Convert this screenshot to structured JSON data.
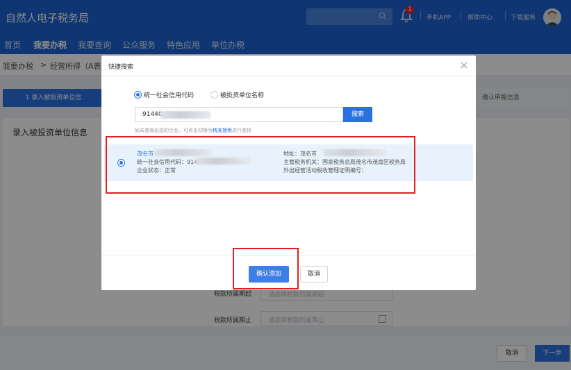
{
  "header": {
    "logo": "自然人电子税务局",
    "notification_count": "1",
    "links": [
      "手机APP",
      "帮助中心",
      "下载服务"
    ]
  },
  "nav": [
    "首页",
    "我要办税",
    "我要查询",
    "公众服务",
    "特色应用",
    "单位办税"
  ],
  "breadcrumb": {
    "root": "我要办税",
    "sep": ">",
    "current": "经营所得（A表"
  },
  "steps": {
    "active": "1  录入被投资单位信",
    "right": "确认申报信息"
  },
  "panel": {
    "title": "录入被投资单位信息",
    "period_start_label": "税款所属期起",
    "period_start_placeholder": "请选择税款所属期起",
    "period_end_label": "税款所属期止",
    "period_end_placeholder": "请选择税款所属期止"
  },
  "footer": {
    "cancel": "取消",
    "next": "下一步"
  },
  "modal": {
    "title": "快捷搜索",
    "radio_options": [
      {
        "label": "统一社会信用代码",
        "checked": true
      },
      {
        "label": "被投资单位名称",
        "checked": false
      }
    ],
    "query_value": "91440",
    "search_button": "搜索",
    "hint_prefix": "如未查询出您的企业，可点击切换为",
    "hint_link": "精准搜索",
    "hint_suffix": "进行查找",
    "result": {
      "name": "茂名市",
      "credit_code_label": "统一社会信用代码：9144",
      "status": "企业状态：正常",
      "address_label": "地址：茂名市",
      "tax_authority": "主管税务机关：国家税务总局茂名市茂南区税务局",
      "cert_no": "外出经营活动税收管理证明编号："
    },
    "confirm_button": "确认添加",
    "cancel_button": "取消"
  },
  "colors": {
    "brand": "#1d63d1",
    "accent": "#2b70e0",
    "highlight": "#e02020"
  }
}
